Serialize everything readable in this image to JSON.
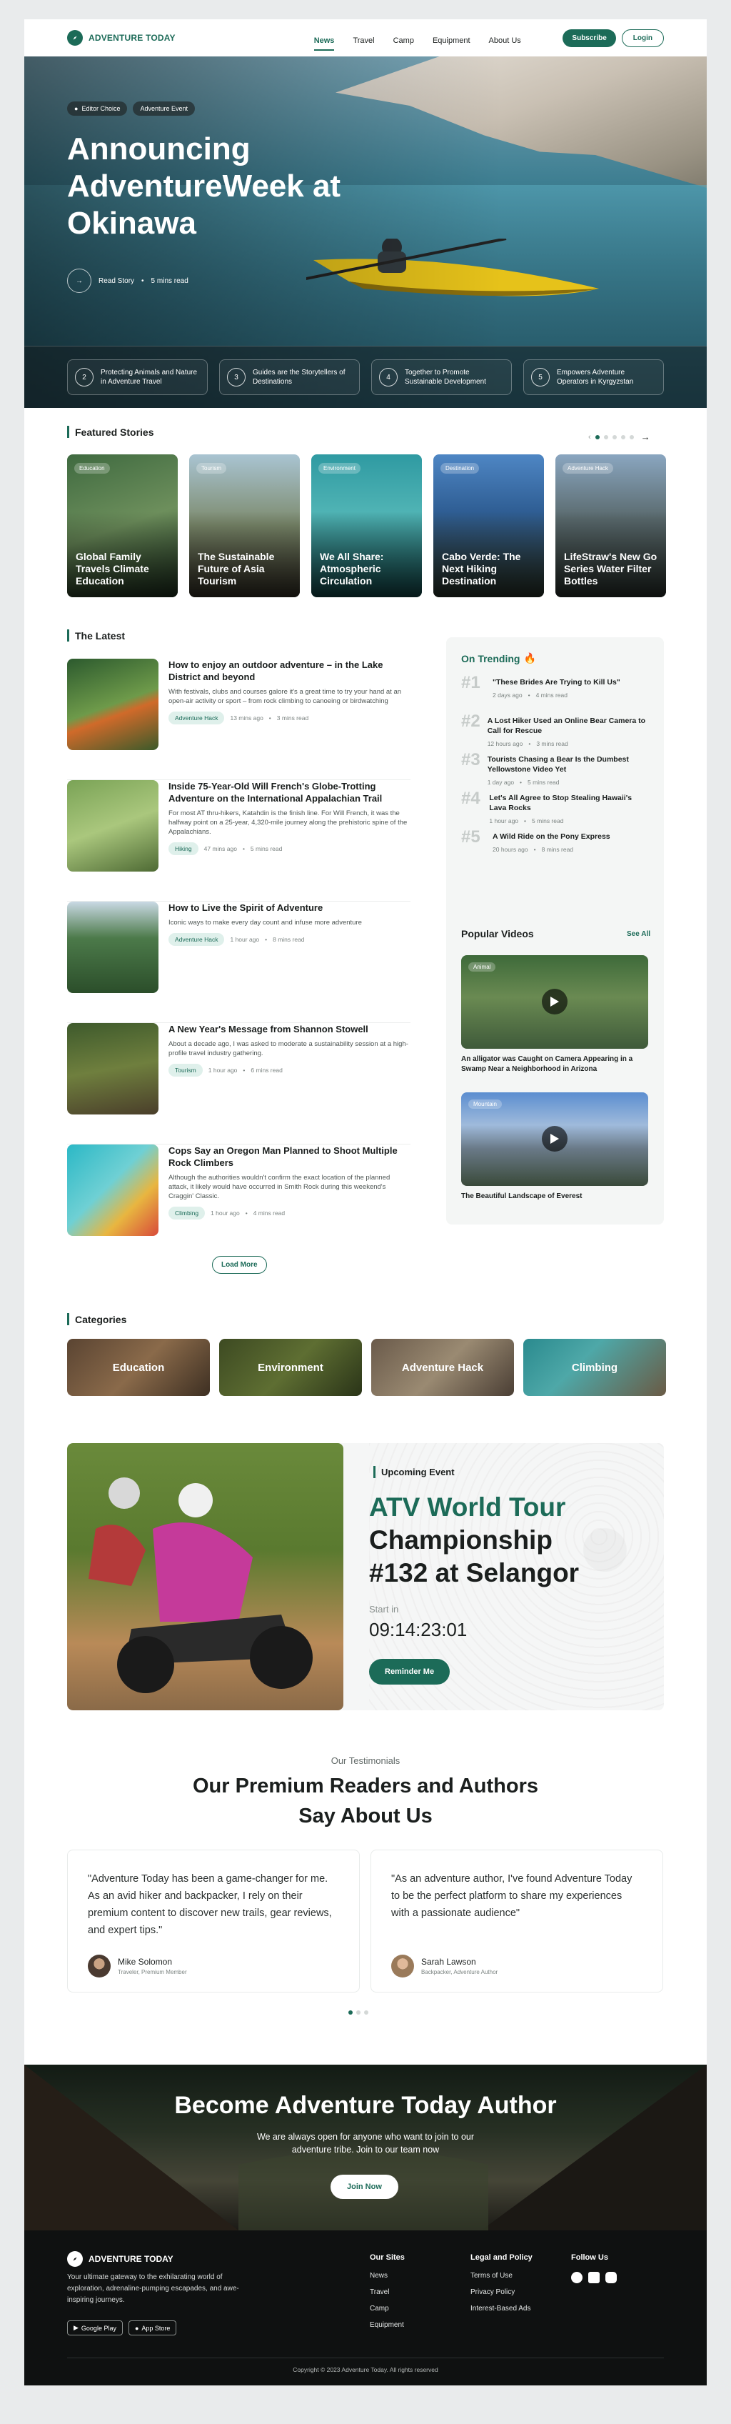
{
  "brand": {
    "name": "ADVENTURE TODAY",
    "accent": "#1c6b58"
  },
  "nav": {
    "items": [
      "News",
      "Travel",
      "Camp",
      "Equipment",
      "About Us"
    ],
    "active": "News",
    "subscribe": "Subscribe",
    "login": "Login"
  },
  "hero": {
    "tags": [
      "Editor Choice",
      "Adventure Event"
    ],
    "title": "Announcing AdventureWeek at Okinawa",
    "read_story": "Read Story",
    "read_time": "5 mins read",
    "cards": [
      {
        "n": "2",
        "text": "Protecting Animals and Nature in Adventure Travel"
      },
      {
        "n": "3",
        "text": "Guides are the Storytellers of Destinations"
      },
      {
        "n": "4",
        "text": "Together to Promote Sustainable Development"
      },
      {
        "n": "5",
        "text": "Empowers Adventure Operators in Kyrgyzstan"
      }
    ]
  },
  "featured": {
    "title": "Featured Stories",
    "items": [
      {
        "tag": "Education",
        "title": "Global Family Travels Climate Education"
      },
      {
        "tag": "Tourism",
        "title": "The Sustainable Future of Asia Tourism"
      },
      {
        "tag": "Environment",
        "title": "We All Share: Atmospheric Circulation"
      },
      {
        "tag": "Destination",
        "title": "Cabo Verde: The Next Hiking Destination"
      },
      {
        "tag": "Adventure Hack",
        "title": "LifeStraw's New Go Series Water Filter Bottles"
      }
    ]
  },
  "latest": {
    "title": "The Latest",
    "load_more": "Load More",
    "items": [
      {
        "title": "How to enjoy an outdoor adventure – in the Lake District and beyond",
        "desc": "With festivals, clubs and courses galore it's a great time to try your hand at an open-air activity or sport – from rock climbing to canoeing or birdwatching",
        "tag": "Adventure Hack",
        "time": "13 mins ago",
        "read": "3 mins read"
      },
      {
        "title": "Inside 75-Year-Old Will French's Globe-Trotting Adventure on the International Appalachian Trail",
        "desc": "For most AT thru-hikers, Katahdin is the finish line. For Will French, it was the halfway point on a 25-year, 4,320-mile journey along the prehistoric spine of the Appalachians.",
        "tag": "Hiking",
        "time": "47 mins ago",
        "read": "5 mins read"
      },
      {
        "title": "How to Live the Spirit of Adventure",
        "desc": "Iconic ways to make every day count and infuse more adventure",
        "tag": "Adventure Hack",
        "time": "1 hour ago",
        "read": "8 mins read"
      },
      {
        "title": "A New Year's Message from Shannon Stowell",
        "desc": "About a decade ago, I was asked to moderate a sustainability session at a high-profile travel industry gathering.",
        "tag": "Tourism",
        "time": "1 hour ago",
        "read": "6 mins read"
      },
      {
        "title": "Cops Say an Oregon Man Planned to Shoot Multiple Rock Climbers",
        "desc": "Although the authorities wouldn't confirm the exact location of the planned attack, it likely would have occurred in Smith Rock during this weekend's Craggin' Classic.",
        "tag": "Climbing",
        "time": "1 hour ago",
        "read": "4 mins read"
      }
    ]
  },
  "trending": {
    "title": "On Trending",
    "items": [
      {
        "n": "#1",
        "title": "\"These Brides Are Trying to Kill Us\"",
        "time": "2 days ago",
        "read": "4 mins read"
      },
      {
        "n": "#2",
        "title": "A Lost Hiker Used an Online Bear Camera to Call for Rescue",
        "time": "12 hours ago",
        "read": "3 mins read"
      },
      {
        "n": "#3",
        "title": "Tourists Chasing a Bear Is the Dumbest Yellowstone Video Yet",
        "time": "1 day ago",
        "read": "5 mins read"
      },
      {
        "n": "#4",
        "title": "Let's All Agree to Stop Stealing Hawaii's Lava Rocks",
        "time": "1 hour ago",
        "read": "5 mins read"
      },
      {
        "n": "#5",
        "title": "A Wild Ride on the Pony Express",
        "time": "20 hours ago",
        "read": "8 mins read"
      }
    ]
  },
  "videos": {
    "title": "Popular Videos",
    "see_all": "See All",
    "items": [
      {
        "tag": "Animal",
        "caption": "An alligator was Caught on Camera Appearing in a Swamp Near a Neighborhood in Arizona"
      },
      {
        "tag": "Mountain",
        "caption": "The Beautiful Landscape of Everest"
      }
    ]
  },
  "categories": {
    "title": "Categories",
    "items": [
      "Education",
      "Environment",
      "Adventure Hack",
      "Climbing"
    ]
  },
  "event": {
    "label": "Upcoming Event",
    "title_accent": "ATV World Tour",
    "title_rest": "Championship #132 at Selangor",
    "start_label": "Start in",
    "countdown": "09:14:23:01",
    "button": "Reminder Me"
  },
  "testimonials": {
    "kicker": "Our Testimonials",
    "title": "Our Premium Readers and Authors Say About Us",
    "items": [
      {
        "quote": "\"Adventure Today has been a game-changer for me. As an avid hiker and backpacker, I rely on their premium content to discover new trails, gear reviews, and expert tips.\"",
        "name": "Mike Solomon",
        "role": "Traveler, Premium Member"
      },
      {
        "quote": "\"As an adventure author, I've found Adventure Today to be the perfect platform to share my experiences with a passionate audience\"",
        "name": "Sarah Lawson",
        "role": "Backpacker, Adventure Author"
      }
    ]
  },
  "cta": {
    "title": "Become Adventure Today Author",
    "text": "We are always open for anyone who want to join to our adventure tribe. Join to our team now",
    "button": "Join Now"
  },
  "footer": {
    "brand": "ADVENTURE TODAY",
    "desc": "Your ultimate gateway to the exhilarating world of exploration, adrenaline-pumping escapades, and awe-inspiring journeys.",
    "stores": [
      "Google Play",
      "App Store"
    ],
    "cols": [
      {
        "title": "Our Sites",
        "links": [
          "News",
          "Travel",
          "Camp",
          "Equipment"
        ]
      },
      {
        "title": "Legal and Policy",
        "links": [
          "Terms of Use",
          "Privacy Policy",
          "Interest-Based Ads"
        ]
      }
    ],
    "follow": "Follow Us",
    "copyright": "Copyright © 2023 Adventure Today. All rights reserved"
  }
}
